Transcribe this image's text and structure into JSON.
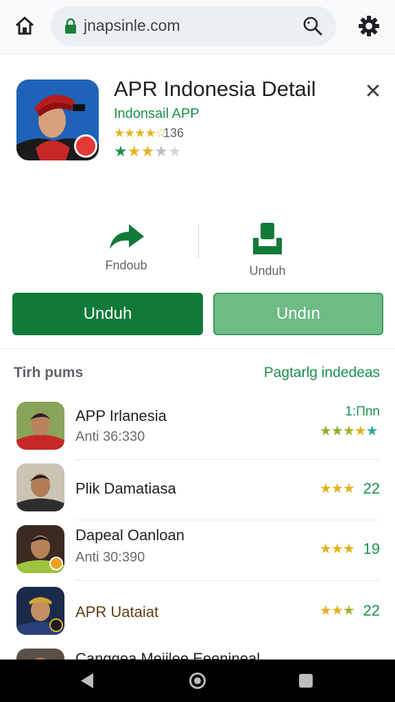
{
  "browser": {
    "url": "jnapsinle.com"
  },
  "app": {
    "title": "APR Indonesia Detail",
    "developer": "Indonsail APP",
    "rating_count": "136",
    "rating_value": 3
  },
  "actions": {
    "share_label": "Fndoub",
    "download_label": "Unduh"
  },
  "buttons": {
    "primary": "Unduh",
    "secondary": "Undın"
  },
  "section": {
    "title": "Tirh pums",
    "link": "Pagtarlg indedeas"
  },
  "list": [
    {
      "name": "APP Irlanesia",
      "sub": "Anti 36:330",
      "value": "1:Πnn",
      "stars": 4
    },
    {
      "name": "Plik Damatiasa",
      "sub": "",
      "value": "22",
      "stars": 3
    },
    {
      "name": "Dapeal Oanloan",
      "sub": "Anti 30:390",
      "value": "19",
      "stars": 3
    },
    {
      "name": "APR Uataiat",
      "sub": "",
      "value": "22",
      "stars": 3
    },
    {
      "name": "Canggea Meiilee Eeenineal",
      "sub": "",
      "value": "",
      "stars": 0
    }
  ],
  "colors": {
    "accent": "#127a38",
    "link": "#1a8f4e",
    "star": "#e0b420"
  }
}
